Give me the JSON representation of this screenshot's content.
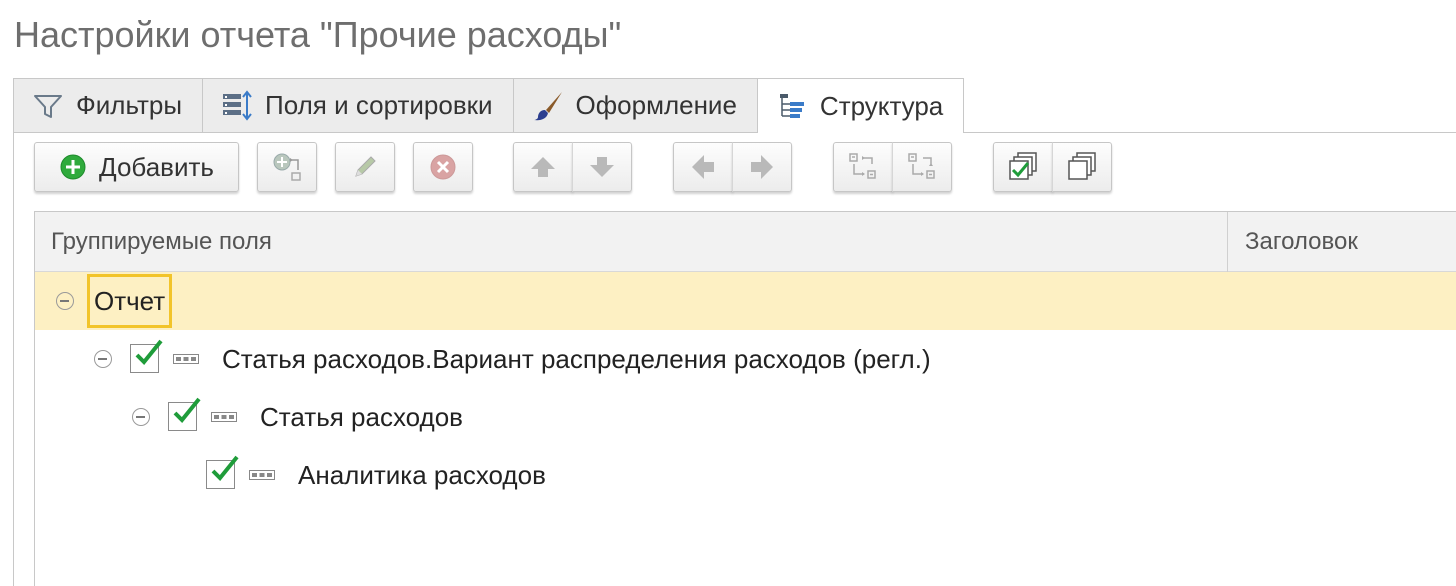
{
  "window": {
    "title": "Настройки отчета \"Прочие расходы\""
  },
  "tabs": [
    {
      "label": "Фильтры",
      "icon": "filter-icon",
      "active": false
    },
    {
      "label": "Поля и сортировки",
      "icon": "fields-sort-icon",
      "active": false
    },
    {
      "label": "Оформление",
      "icon": "brush-icon",
      "active": false
    },
    {
      "label": "Структура",
      "icon": "structure-icon",
      "active": true
    }
  ],
  "toolbar": {
    "add_label": "Добавить",
    "icons": [
      "add-icon",
      "group-insert-icon",
      "edit-icon",
      "delete-icon",
      "move-up-icon",
      "move-down-icon",
      "move-left-icon",
      "move-right-icon",
      "move-group-icon",
      "ungroup-icon",
      "check-all-icon",
      "uncheck-all-icon"
    ]
  },
  "grid": {
    "columns": [
      "Группируемые поля",
      "Заголовок"
    ],
    "rows": [
      {
        "label": "Отчет",
        "level": 0,
        "collapsible": true,
        "checkbox": false,
        "checked": false,
        "selected": true
      },
      {
        "label": "Статья расходов.Вариант распределения расходов (регл.)",
        "level": 1,
        "collapsible": true,
        "checkbox": true,
        "checked": true,
        "selected": false
      },
      {
        "label": "Статья расходов",
        "level": 2,
        "collapsible": true,
        "checkbox": true,
        "checked": true,
        "selected": false
      },
      {
        "label": "Аналитика расходов",
        "level": 3,
        "collapsible": false,
        "checkbox": true,
        "checked": true,
        "selected": false
      }
    ]
  },
  "colors": {
    "selected_row": "#fdf0c3",
    "selection_border": "#f2c42a",
    "check_green": "#1f9c3a",
    "add_green": "#2faa3c"
  }
}
